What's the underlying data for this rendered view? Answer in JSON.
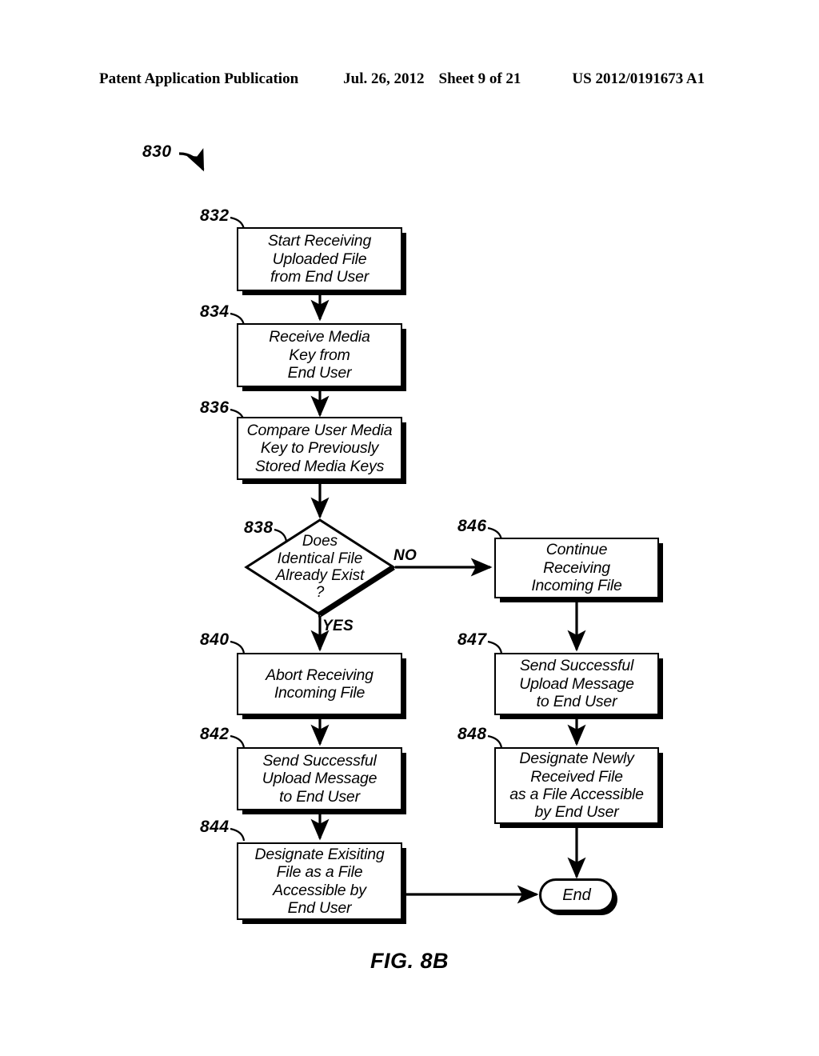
{
  "header": {
    "title": "Patent Application Publication",
    "date": "Jul. 26, 2012",
    "sheet": "Sheet 9 of 21",
    "publication_number": "US 2012/0191673 A1"
  },
  "figure": {
    "caption": "FIG. 8B",
    "diagram_ref": "830",
    "line_color": "#000000",
    "fill_color": "#ffffff"
  },
  "nodes": {
    "n832": {
      "ref": "832",
      "text": "Start Receiving\nUploaded File\nfrom End User"
    },
    "n834": {
      "ref": "834",
      "text": "Receive Media\nKey from\nEnd User"
    },
    "n836": {
      "ref": "836",
      "text": "Compare User Media\nKey to Previously\nStored Media Keys"
    },
    "n838": {
      "ref": "838",
      "text": "Does\nIdentical File\nAlready Exist\n?"
    },
    "n840": {
      "ref": "840",
      "text": "Abort Receiving\nIncoming File"
    },
    "n842": {
      "ref": "842",
      "text": "Send Successful\nUpload Message\nto End User"
    },
    "n844": {
      "ref": "844",
      "text": "Designate Exisiting\nFile as a File\nAccessible by\nEnd User"
    },
    "n846": {
      "ref": "846",
      "text": "Continue\nReceiving\nIncoming File"
    },
    "n847": {
      "ref": "847",
      "text": "Send Successful\nUpload Message\nto End User"
    },
    "n848": {
      "ref": "848",
      "text": "Designate Newly\nReceived File\nas a File Accessible\nby End User"
    },
    "end": {
      "text": "End"
    }
  },
  "branches": {
    "yes": "YES",
    "no": "NO"
  }
}
